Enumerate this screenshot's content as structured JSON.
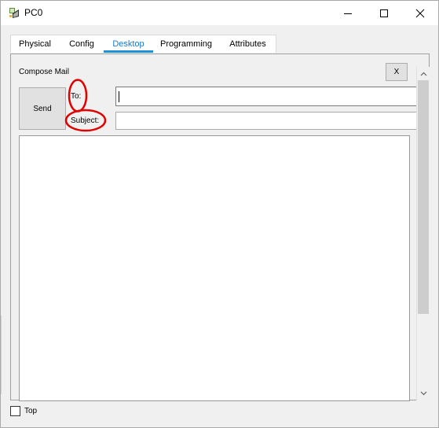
{
  "window": {
    "title": "PC0",
    "icon": "packet-tracer-pc-icon",
    "controls": [
      "minimize-icon",
      "maximize-icon",
      "close-icon"
    ]
  },
  "tabs": [
    {
      "label": "Physical",
      "active": false
    },
    {
      "label": "Config",
      "active": false
    },
    {
      "label": "Desktop",
      "active": true
    },
    {
      "label": "Programming",
      "active": false
    },
    {
      "label": "Attributes",
      "active": false
    }
  ],
  "compose": {
    "title": "Compose Mail",
    "close_label": "X",
    "send_label": "Send",
    "to_label": "To:",
    "to_value": "",
    "subject_label": "Subject:",
    "subject_value": "",
    "body_value": ""
  },
  "annotations": {
    "color": "#e00000",
    "circled": [
      "To:",
      "Subject:"
    ]
  },
  "footer": {
    "top_label": "Top",
    "top_checked": false
  },
  "colors": {
    "active_tab_text": "#1979ca",
    "active_tab_underline": "#1e90d6"
  }
}
